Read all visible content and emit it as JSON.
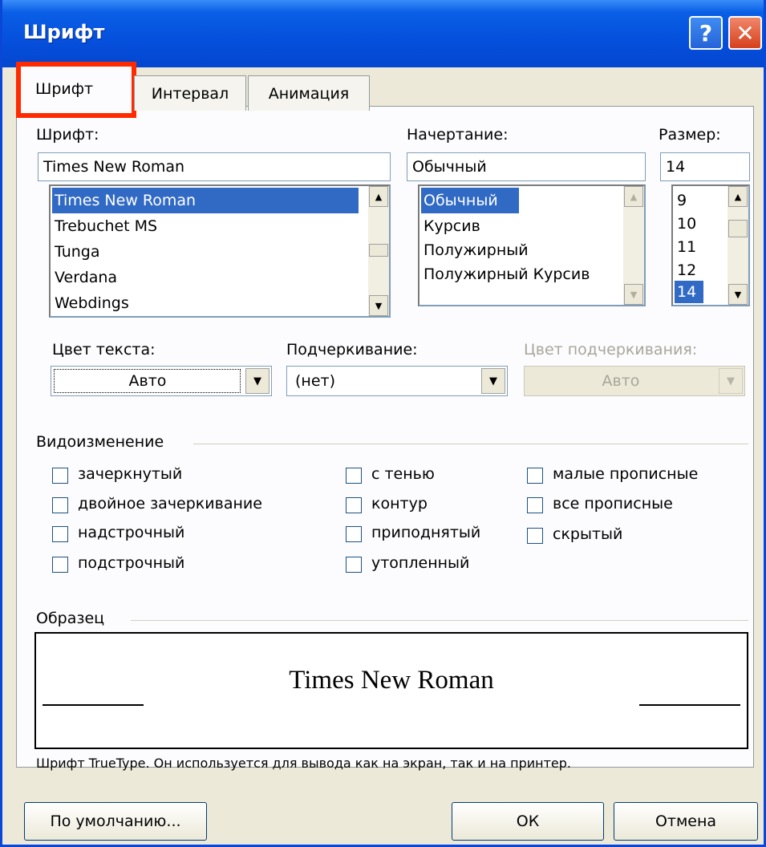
{
  "window": {
    "title": "Шрифт"
  },
  "titlebar": {
    "help": "?",
    "close": "✕"
  },
  "tabs": [
    {
      "label": "Шрифт"
    },
    {
      "label": "Интервал"
    },
    {
      "label": "Анимация"
    }
  ],
  "font": {
    "label": "Шрифт:",
    "value": "Times New Roman",
    "items": [
      "Times New Roman",
      "Trebuchet MS",
      "Tunga",
      "Verdana",
      "Webdings"
    ]
  },
  "style": {
    "label": "Начертание:",
    "value": "Обычный",
    "items": [
      "Обычный",
      "Курсив",
      "Полужирный",
      "Полужирный Курсив"
    ]
  },
  "size": {
    "label": "Размер:",
    "value": "14",
    "items": [
      "9",
      "10",
      "11",
      "12",
      "14"
    ]
  },
  "color": {
    "label": "Цвет текста:",
    "value": "Авто"
  },
  "underline": {
    "label": "Подчеркивание:",
    "value": "(нет)"
  },
  "underline_color": {
    "label": "Цвет подчеркивания:",
    "value": "Авто"
  },
  "effects": {
    "label": "Видоизменение",
    "col1": [
      "зачеркнутый",
      "двойное зачеркивание",
      "надстрочный",
      "подстрочный"
    ],
    "col2": [
      "с тенью",
      "контур",
      "приподнятый",
      "утопленный"
    ],
    "col3": [
      "малые прописные",
      "все прописные",
      "скрытый"
    ]
  },
  "preview": {
    "label": "Образец",
    "text": "Times New Roman",
    "note": "Шрифт TrueType. Он используется для вывода как на экран, так и на принтер."
  },
  "buttons": {
    "default": "По умолчанию...",
    "ok": "ОК",
    "cancel": "Отмена"
  }
}
